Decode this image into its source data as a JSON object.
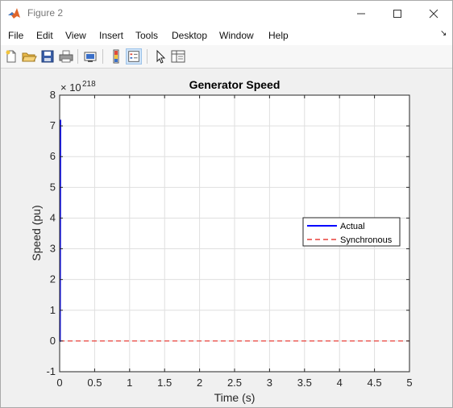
{
  "window": {
    "title": "Figure 2"
  },
  "menu": {
    "items": [
      "File",
      "Edit",
      "View",
      "Insert",
      "Tools",
      "Desktop",
      "Window",
      "Help"
    ],
    "overflow_icon": "dock-arrow-icon"
  },
  "toolbar": {
    "buttons": [
      "new-figure-icon",
      "open-file-icon",
      "save-icon",
      "print-icon",
      "link-plot-icon",
      "insert-colorbar-icon",
      "insert-legend-icon",
      "edit-plot-arrow-icon",
      "property-inspector-icon"
    ]
  },
  "chart_data": {
    "type": "line",
    "title": "Generator Speed",
    "xlabel": "Time (s)",
    "ylabel": "Speed (pu)",
    "exponent_label": "× 10^218",
    "exponent_base": "× 10",
    "exponent_power": "218",
    "xlim": [
      0,
      5
    ],
    "ylim": [
      -1,
      8
    ],
    "xticks": [
      0,
      0.5,
      1,
      1.5,
      2,
      2.5,
      3,
      3.5,
      4,
      4.5,
      5
    ],
    "xtick_labels": [
      "0",
      "0.5",
      "1",
      "1.5",
      "2",
      "2.5",
      "3",
      "3.5",
      "4",
      "4.5",
      "5"
    ],
    "yticks": [
      -1,
      0,
      1,
      2,
      3,
      4,
      5,
      6,
      7,
      8
    ],
    "ytick_labels": [
      "-1",
      "0",
      "1",
      "2",
      "3",
      "4",
      "5",
      "6",
      "7",
      "8"
    ],
    "grid": true,
    "legend_position": "right",
    "series": [
      {
        "name": "Actual",
        "color": "#0000ff",
        "style": "solid",
        "x": [
          0,
          0.005,
          0.01
        ],
        "y": [
          0,
          0,
          7.2
        ]
      },
      {
        "name": "Synchronous",
        "color": "#e8413a",
        "style": "dashed",
        "x": [
          0,
          5
        ],
        "y": [
          0,
          0
        ]
      }
    ]
  }
}
